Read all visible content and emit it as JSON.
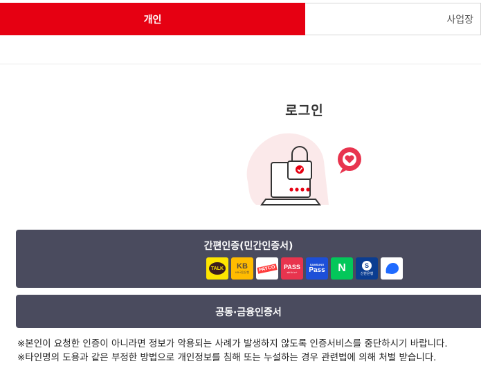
{
  "tabs": {
    "personal": "개인",
    "business": "사업장"
  },
  "login": {
    "title": "로그인"
  },
  "simple_auth": {
    "title": "간편인증(민간인증서)",
    "providers": [
      {
        "name": "kakao-talk-icon",
        "label": "TALK",
        "bg": "#fee500",
        "fg": "#3c1e1e"
      },
      {
        "name": "kb-icon",
        "label": "KB",
        "sub": "KB국민은행",
        "bg": "#ffbc00",
        "fg": "#5a4a3a"
      },
      {
        "name": "payco-icon",
        "label": "PAYCO",
        "bg": "#ffffff",
        "fg": "#ffffff",
        "accent": "#ff3c3c"
      },
      {
        "name": "pass-icon",
        "label": "PASS",
        "sub": "skt kt u+",
        "bg": "#e8344e",
        "fg": "#ffffff"
      },
      {
        "name": "samsung-pass-icon",
        "label": "Pass",
        "sub": "SAMSUNG",
        "bg": "#1d4fd8",
        "fg": "#ffffff"
      },
      {
        "name": "naver-icon",
        "label": "N",
        "bg": "#03c75a",
        "fg": "#ffffff"
      },
      {
        "name": "shinhan-icon",
        "label": "S",
        "sub": "신한은행",
        "bg": "#0b3d91",
        "fg": "#ffffff"
      },
      {
        "name": "toss-icon",
        "label": "",
        "bg": "#ffffff",
        "fg": "#1f6bff"
      }
    ]
  },
  "public_cert": {
    "title": "공동·금융인증서"
  },
  "notices": [
    "※본인이 요청한 인증이 아니라면 정보가 악용되는 사례가 발생하지 않도록 인증서비스를 중단하시기 바랍니다.",
    "※타인명의 도용과 같은 부정한 방법으로 개인정보를 침해 또는 누설하는 경우 관련법에 의해 처벌 받습니다."
  ],
  "colors": {
    "brand_red": "#e60012",
    "panel": "#4a4b5e"
  }
}
